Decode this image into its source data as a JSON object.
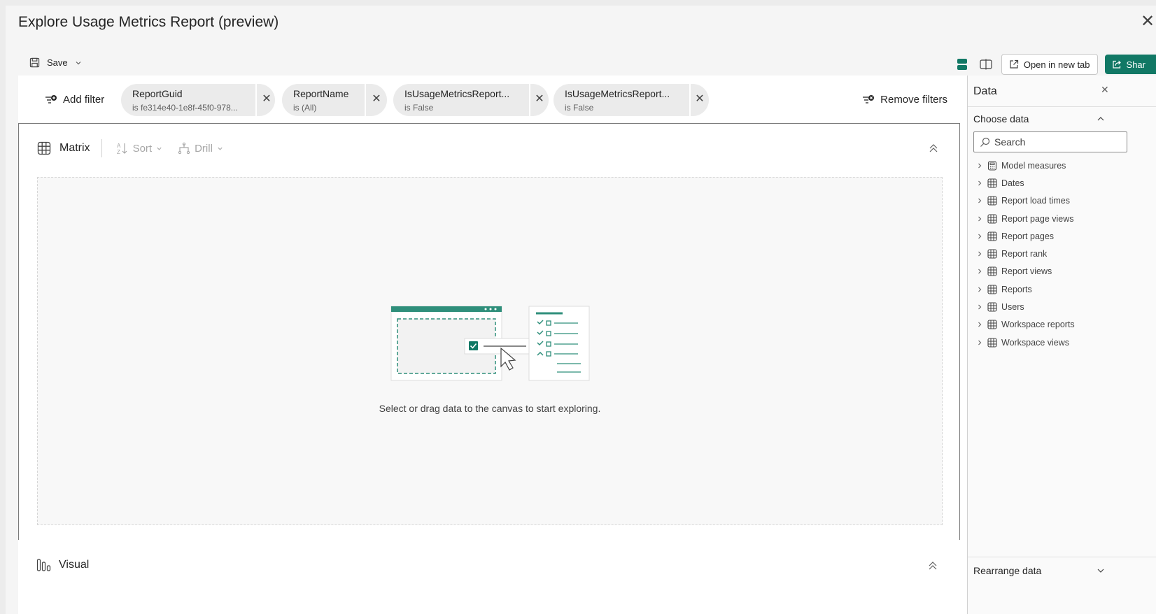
{
  "dialog": {
    "title": "Explore Usage Metrics Report (preview)"
  },
  "toolbar": {
    "save_label": "Save",
    "open_new_tab_label": "Open in new tab",
    "share_label": "Shar"
  },
  "filters": {
    "add_label": "Add filter",
    "remove_label": "Remove filters",
    "chips": [
      {
        "name": "ReportGuid",
        "value": "is fe314e40-1e8f-45f0-978..."
      },
      {
        "name": "ReportName",
        "value": "is (All)"
      },
      {
        "name": "IsUsageMetricsReport...",
        "value": "is False"
      },
      {
        "name": "IsUsageMetricsReport...",
        "value": "is False"
      }
    ]
  },
  "matrix": {
    "label": "Matrix",
    "sort_label": "Sort",
    "drill_label": "Drill",
    "empty_message": "Select or drag data to the canvas to start exploring."
  },
  "visual": {
    "label": "Visual"
  },
  "data_pane": {
    "title": "Data",
    "choose_label": "Choose data",
    "search_placeholder": "Search",
    "items": [
      {
        "label": "Model measures",
        "icon": "calculator-icon"
      },
      {
        "label": "Dates",
        "icon": "table-icon"
      },
      {
        "label": "Report load times",
        "icon": "table-icon"
      },
      {
        "label": "Report page views",
        "icon": "table-icon"
      },
      {
        "label": "Report pages",
        "icon": "table-icon"
      },
      {
        "label": "Report rank",
        "icon": "table-icon"
      },
      {
        "label": "Report views",
        "icon": "table-icon"
      },
      {
        "label": "Reports",
        "icon": "table-icon"
      },
      {
        "label": "Users",
        "icon": "table-icon"
      },
      {
        "label": "Workspace reports",
        "icon": "table-icon"
      },
      {
        "label": "Workspace views",
        "icon": "table-icon"
      }
    ],
    "rearrange_label": "Rearrange data"
  },
  "colors": {
    "accent": "#117865",
    "illustration": "#2f8f7b"
  }
}
